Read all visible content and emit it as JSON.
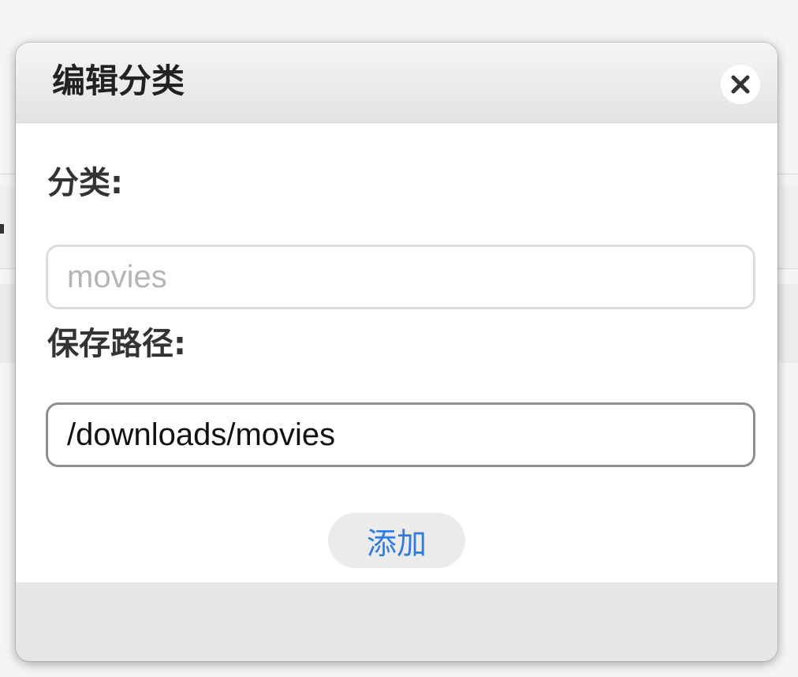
{
  "dialog": {
    "title": "编辑分类",
    "close_icon": "close-icon"
  },
  "form": {
    "category_label": "分类:",
    "category_value": "movies",
    "save_path_label": "保存路径:",
    "save_path_value": "/downloads/movies",
    "add_button_label": "添加"
  },
  "colors": {
    "accent": "#2f7be0",
    "header_bg": "#e8e8e8",
    "footer_bg": "#e6e6e6"
  }
}
